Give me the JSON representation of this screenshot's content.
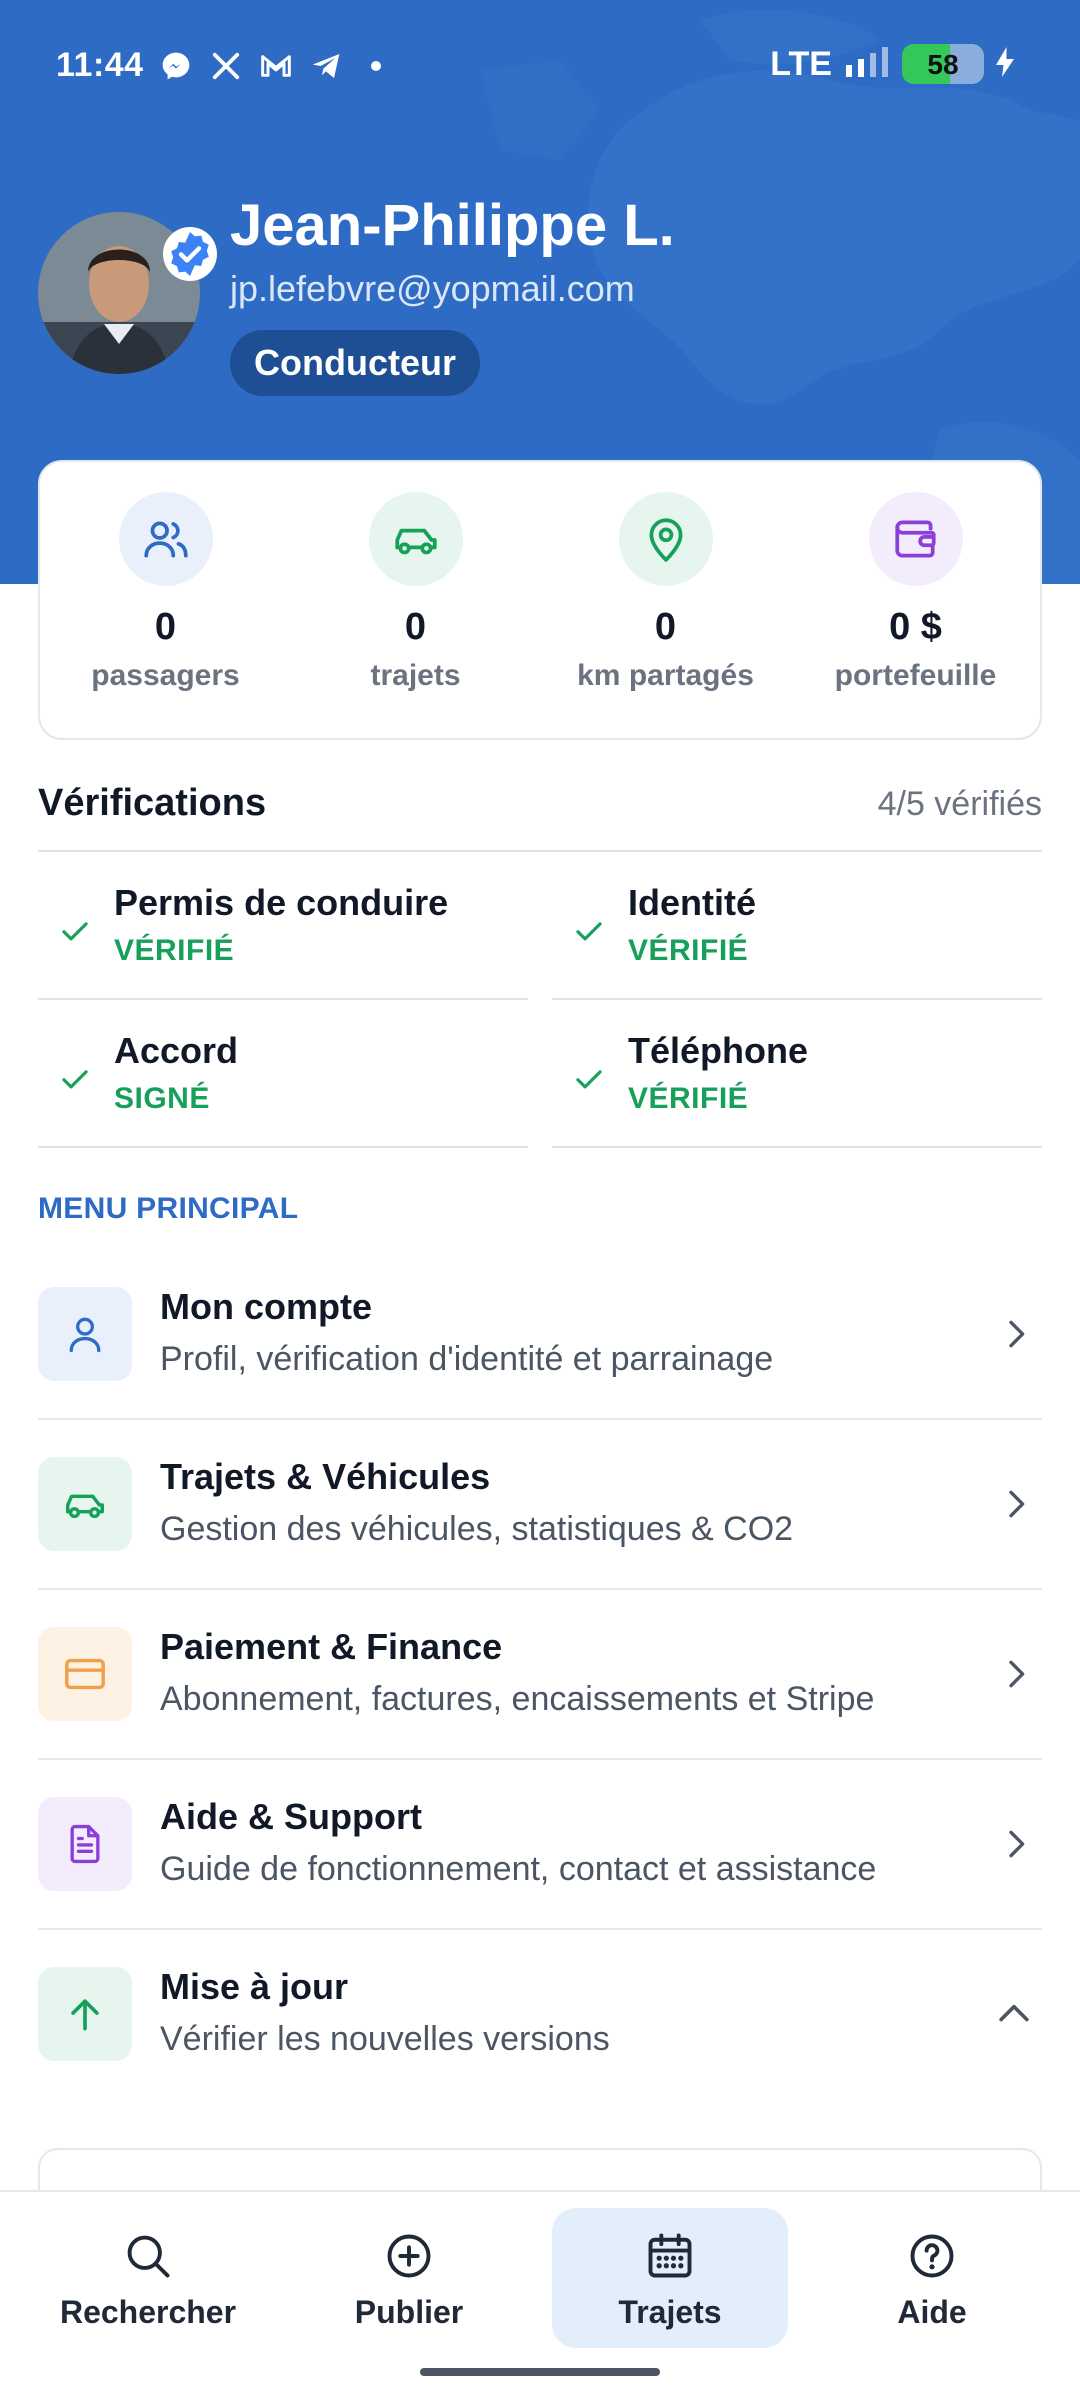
{
  "status_bar": {
    "time": "11:44",
    "network": "LTE",
    "battery": "58",
    "battery_level": 0.58,
    "notification_icons": [
      "messenger-icon",
      "x-icon",
      "gmail-icon",
      "telegram-icon",
      "dot-icon"
    ]
  },
  "profile": {
    "name": "Jean-Philippe L.",
    "email": "jp.lefebvre@yopmail.com",
    "role": "Conducteur",
    "verified": true
  },
  "stats": [
    {
      "value": "0",
      "label": "passagers",
      "icon": "users-icon",
      "color": "#2d6bc4"
    },
    {
      "value": "0",
      "label": "trajets",
      "icon": "car-icon",
      "color": "#16a05a"
    },
    {
      "value": "0",
      "label": "km partagés",
      "icon": "map-pin-icon",
      "color": "#16a05a"
    },
    {
      "value": "0 $",
      "label": "portefeuille",
      "icon": "wallet-icon",
      "color": "#8b3fd9"
    }
  ],
  "verifications": {
    "title": "Vérifications",
    "count": "4/5 vérifiés",
    "items": [
      {
        "title": "Permis de conduire",
        "status": "VÉRIFIÉ"
      },
      {
        "title": "Identité",
        "status": "VÉRIFIÉ"
      },
      {
        "title": "Accord",
        "status": "SIGNÉ"
      },
      {
        "title": "Téléphone",
        "status": "VÉRIFIÉ"
      }
    ]
  },
  "menu": {
    "heading": "MENU PRINCIPAL",
    "items": [
      {
        "title": "Mon compte",
        "subtitle": "Profil, vérification d'identité et parrainage",
        "icon": "user-icon",
        "chevron": "chevron-right-icon"
      },
      {
        "title": "Trajets & Véhicules",
        "subtitle": "Gestion des véhicules, statistiques & CO2",
        "icon": "car-icon",
        "chevron": "chevron-right-icon"
      },
      {
        "title": "Paiement & Finance",
        "subtitle": "Abonnement, factures, encaissements et Stripe",
        "icon": "credit-card-icon",
        "chevron": "chevron-right-icon"
      },
      {
        "title": "Aide & Support",
        "subtitle": "Guide de fonctionnement, contact et assistance",
        "icon": "document-icon",
        "chevron": "chevron-right-icon"
      },
      {
        "title": "Mise à jour",
        "subtitle": "Vérifier les nouvelles versions",
        "icon": "arrow-up-icon",
        "chevron": "chevron-up-icon"
      }
    ]
  },
  "bottom_nav": {
    "active": "Trajets",
    "items": [
      {
        "label": "Rechercher",
        "icon": "search-icon"
      },
      {
        "label": "Publier",
        "icon": "plus-circle-icon"
      },
      {
        "label": "Trajets",
        "icon": "calendar-icon"
      },
      {
        "label": "Aide",
        "icon": "help-circle-icon"
      }
    ]
  },
  "colors": {
    "header": "#2d6bc4",
    "accent_blue": "#2d6bc4",
    "success_green": "#16a05a",
    "purple": "#8b3fd9",
    "orange": "#f0a04b"
  }
}
